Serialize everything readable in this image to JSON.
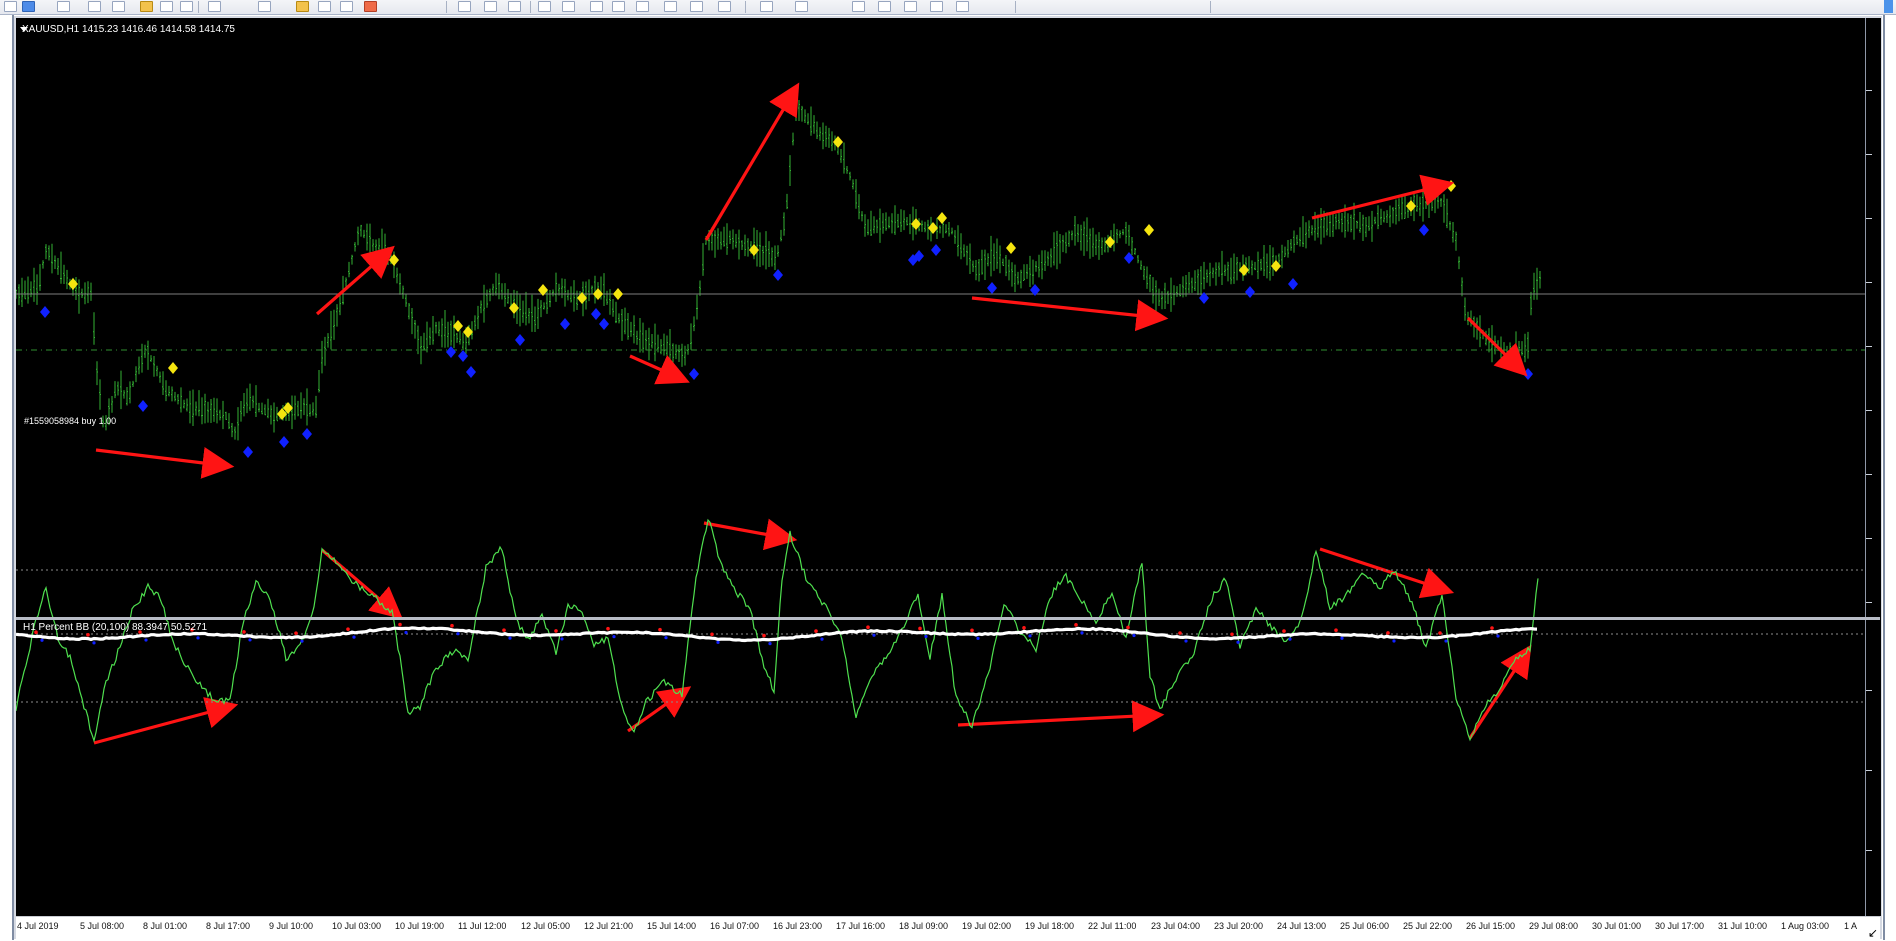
{
  "app": {
    "window": "XAUUSD,H1"
  },
  "main_pane": {
    "title": "XAUUSD,H1  1415.23 1416.46 1414.58 1414.75",
    "order_label": "#1559058984 buy 1.00"
  },
  "indicator_pane": {
    "title": "H1 Percent BB (20,100) 88.3947 50.5271"
  },
  "time_axis": [
    "4 Jul 2019",
    "5 Jul 08:00",
    "8 Jul 01:00",
    "8 Jul 17:00",
    "9 Jul 10:00",
    "10 Jul 03:00",
    "10 Jul 19:00",
    "11 Jul 12:00",
    "12 Jul 05:00",
    "12 Jul 21:00",
    "15 Jul 14:00",
    "16 Jul 07:00",
    "16 Jul 23:00",
    "17 Jul 16:00",
    "18 Jul 09:00",
    "19 Jul 02:00",
    "19 Jul 18:00",
    "22 Jul 11:00",
    "23 Jul 04:00",
    "23 Jul 20:00",
    "24 Jul 13:00",
    "25 Jul 06:00",
    "25 Jul 22:00",
    "26 Jul 15:00",
    "29 Jul 08:00",
    "30 Jul 01:00",
    "30 Jul 17:00",
    "31 Jul 10:00",
    "1 Aug 03:00",
    "1 A"
  ],
  "colors": {
    "background": "#000000",
    "price_bars": "#33b233",
    "indicator_line": "#4fe04f",
    "baseline": "#ffffff",
    "sell_marker": "#f5e50f",
    "buy_marker": "#1021ff",
    "annotation_arrow": "#ff1414",
    "order_line": "#2f8f2f",
    "grid_dotted": "#8c8c8c"
  },
  "icons": {
    "toolbar": [
      "new-chart-icon",
      "profiles-icon",
      "market-watch-icon",
      "navigator-icon",
      "zoom-in-icon",
      "zoom-out-icon",
      "crosshair-icon",
      "line-icon",
      "fibo-icon",
      "period-icon",
      "template-icon"
    ]
  }
}
